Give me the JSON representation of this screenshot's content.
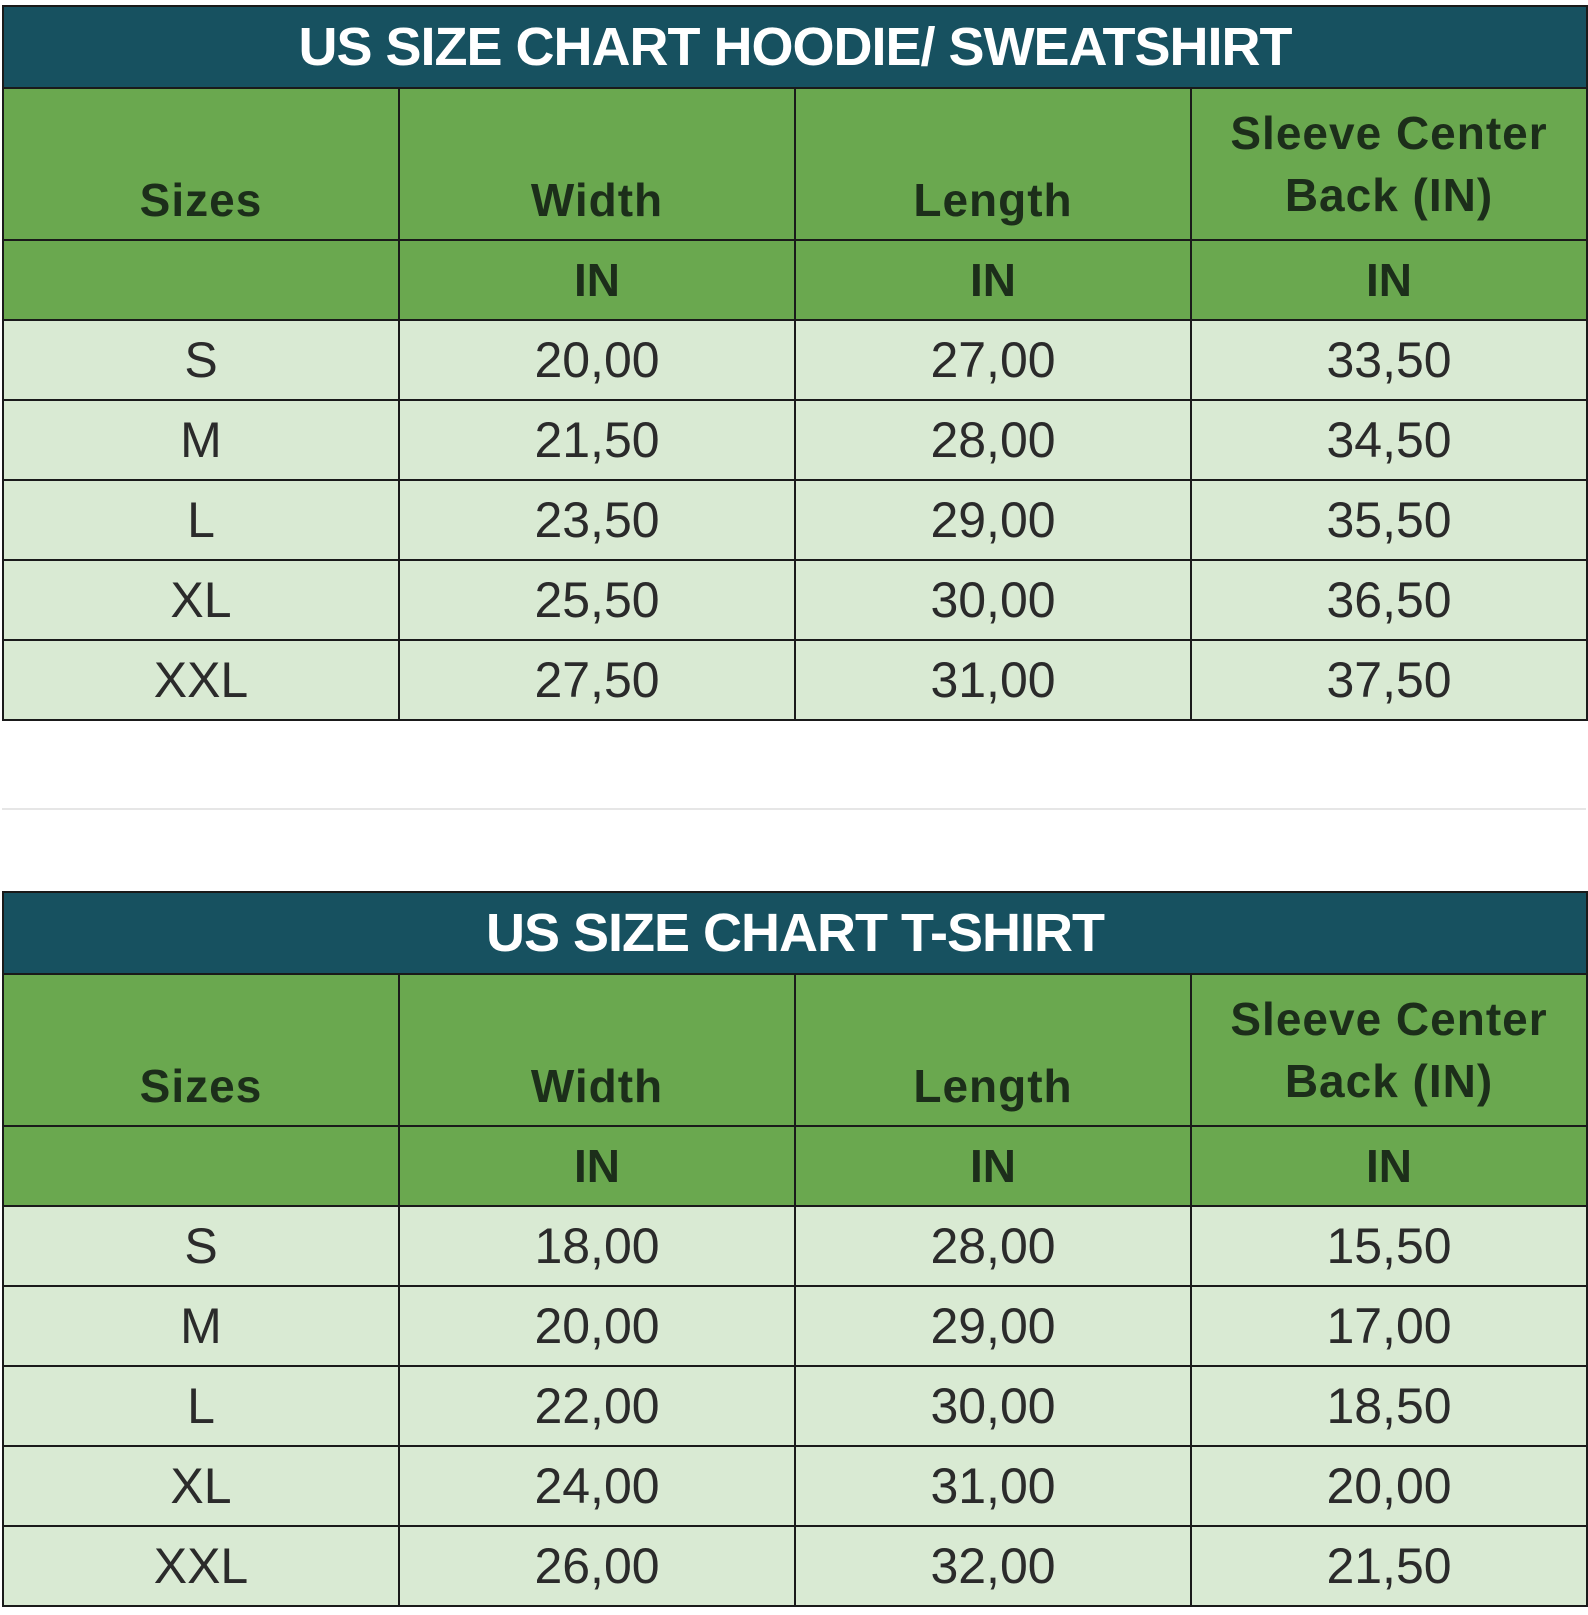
{
  "hoodie_chart": {
    "title": "US SIZE CHART HOODIE/ SWEATSHIRT",
    "headers": [
      "Sizes",
      "Width",
      "Length",
      "Sleeve Center",
      "Back (IN)"
    ],
    "units": [
      "",
      "IN",
      "IN",
      "IN"
    ],
    "rows": [
      [
        "S",
        "20,00",
        "27,00",
        "33,50"
      ],
      [
        "M",
        "21,50",
        "28,00",
        "34,50"
      ],
      [
        "L",
        "23,50",
        "29,00",
        "35,50"
      ],
      [
        "XL",
        "25,50",
        "30,00",
        "36,50"
      ],
      [
        "XXL",
        "27,50",
        "31,00",
        "37,50"
      ]
    ]
  },
  "tshirt_chart": {
    "title": "US SIZE CHART T-SHIRT",
    "headers": [
      "Sizes",
      "Width",
      "Length",
      "Sleeve Center",
      "Back (IN)"
    ],
    "units": [
      "",
      "IN",
      "IN",
      "IN"
    ],
    "rows": [
      [
        "S",
        "18,00",
        "28,00",
        "15,50"
      ],
      [
        "M",
        "20,00",
        "29,00",
        "17,00"
      ],
      [
        "L",
        "22,00",
        "30,00",
        "18,50"
      ],
      [
        "XL",
        "24,00",
        "31,00",
        "20,00"
      ],
      [
        "XXL",
        "26,00",
        "32,00",
        "21,50"
      ]
    ]
  },
  "colors": {
    "title_bg": "#175160",
    "header_bg": "#6aa84f",
    "row_bg": "#d9ead3"
  }
}
